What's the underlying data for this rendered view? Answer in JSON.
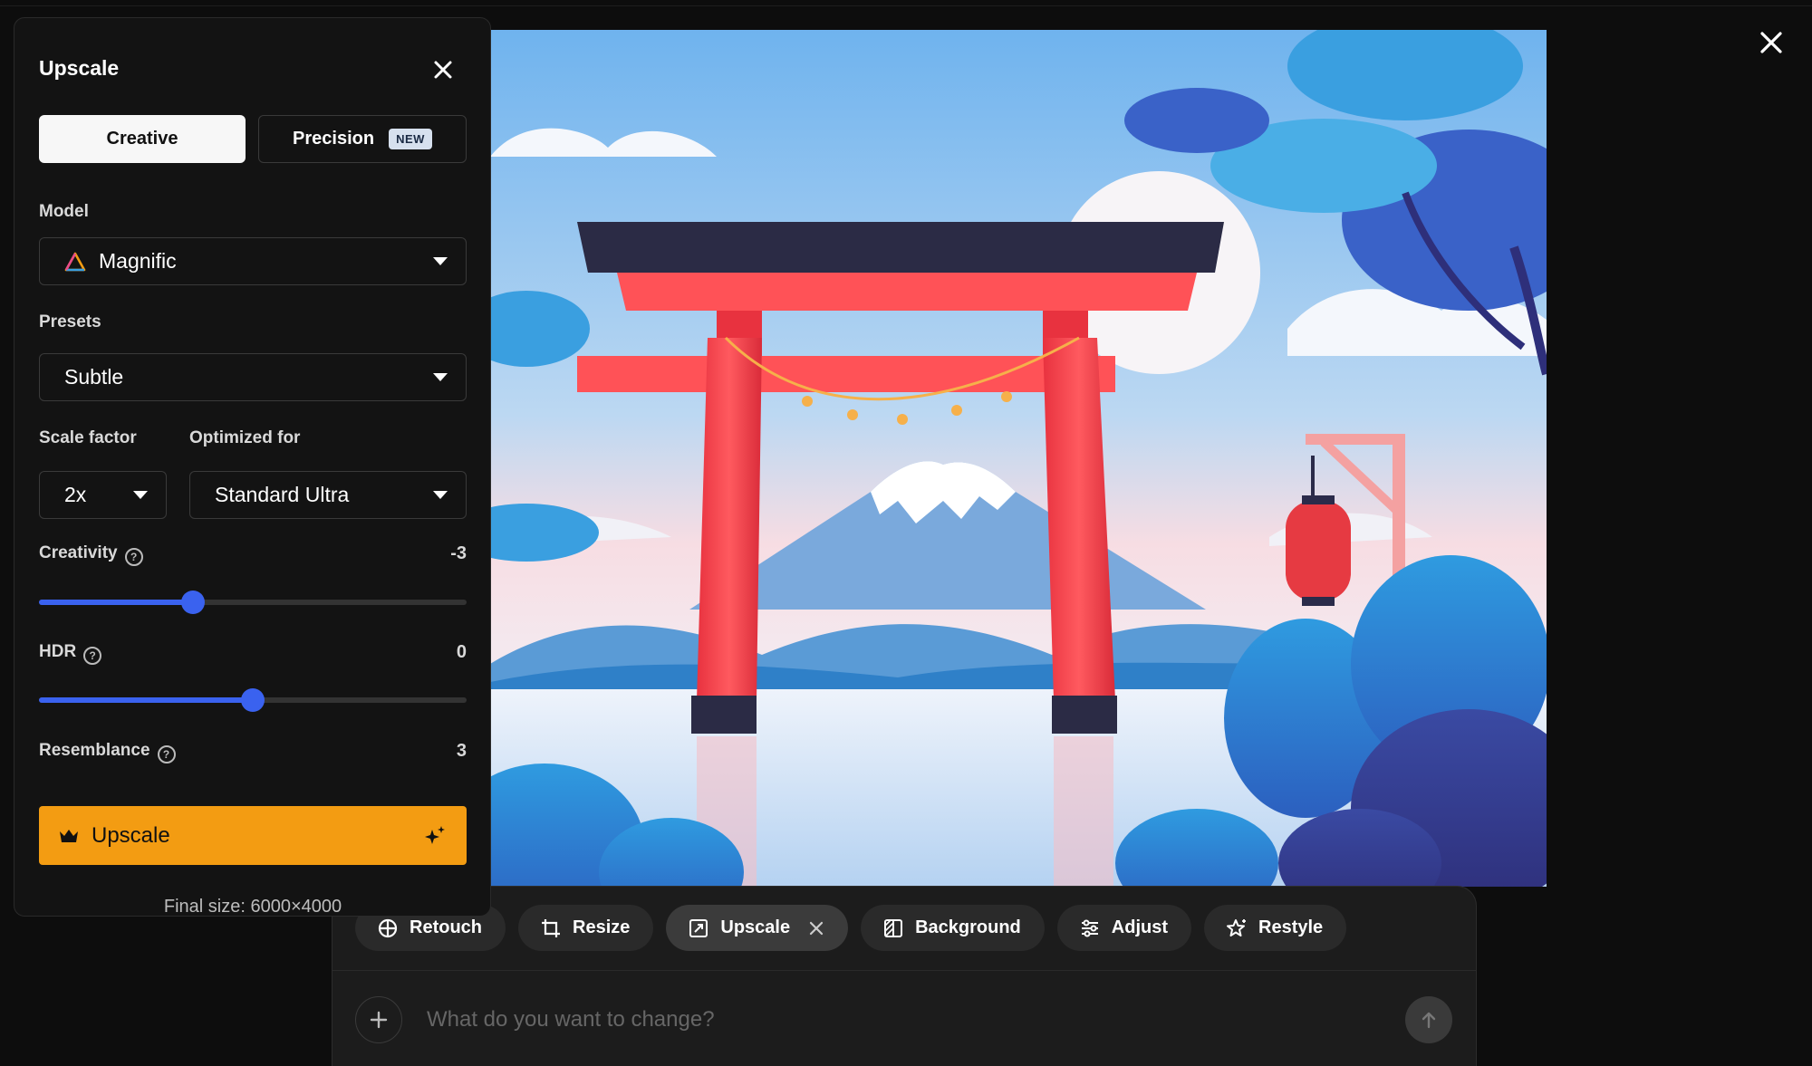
{
  "panel": {
    "title": "Upscale",
    "modes": {
      "creative": "Creative",
      "precision": "Precision",
      "precision_badge": "NEW"
    },
    "model": {
      "label": "Model",
      "value": "Magnific"
    },
    "presets": {
      "label": "Presets",
      "value": "Subtle"
    },
    "scale_factor": {
      "label": "Scale factor",
      "value": "2x"
    },
    "optimized_for": {
      "label": "Optimized for",
      "value": "Standard Ultra"
    },
    "creativity": {
      "label": "Creativity",
      "value": "-3",
      "level": 0.36
    },
    "hdr": {
      "label": "HDR",
      "value": "0",
      "level": 0.5
    },
    "resemblance": {
      "label": "Resemblance",
      "value": "3"
    },
    "upscale_button": "Upscale",
    "final_size": "Final size: 6000×4000"
  },
  "toolbar": {
    "tools": [
      {
        "label": "Retouch"
      },
      {
        "label": "Resize"
      },
      {
        "label": "Upscale"
      },
      {
        "label": "Background"
      },
      {
        "label": "Adjust"
      },
      {
        "label": "Restyle"
      }
    ],
    "active_tool": "Upscale",
    "prompt_placeholder": "What do you want to change?"
  },
  "colors": {
    "accent": "#f39c12",
    "slider": "#3a62ef",
    "panel_bg": "#131313"
  },
  "icons": {
    "tools": [
      "crosshair-icon",
      "crop-icon",
      "upscale-icon",
      "background-icon",
      "sliders-icon",
      "sparkle-star-icon"
    ]
  }
}
